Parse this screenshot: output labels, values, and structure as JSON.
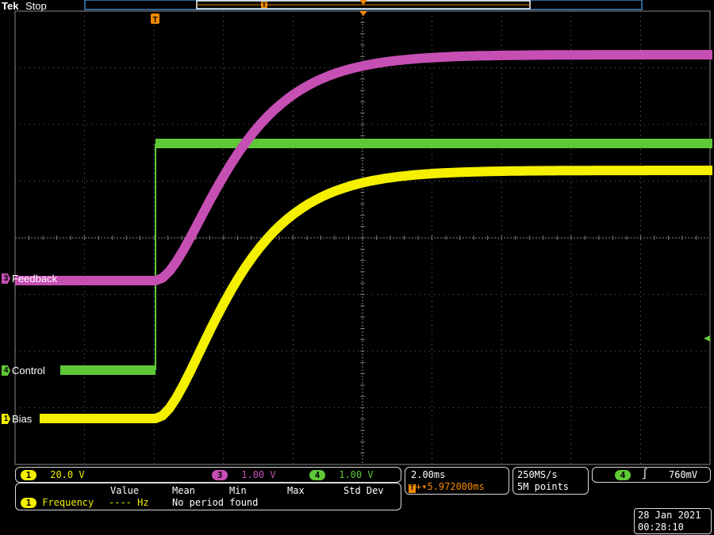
{
  "brand": "Tek",
  "acq_state": "Stop",
  "channels": {
    "ch1": {
      "num": "1",
      "label": "Bias",
      "scale": "20.0 V",
      "color": "#f4f000"
    },
    "ch3": {
      "num": "3",
      "label": "Feedback",
      "scale": "1.00 V",
      "color": "#c64fb4"
    },
    "ch4": {
      "num": "4",
      "label": "Control",
      "scale": "1.00 V",
      "color": "#5fc837"
    }
  },
  "horizontal": {
    "scale": "2.00ms",
    "trigger_position": "5.972000ms"
  },
  "acquisition": {
    "sample_rate": "250MS/s",
    "record_length": "5M points"
  },
  "trigger": {
    "source": "4",
    "slope_icon": "rising-edge-icon",
    "level": "760mV"
  },
  "measurement": {
    "headers": [
      "Value",
      "Mean",
      "Min",
      "Max",
      "Std Dev"
    ],
    "source": "1",
    "name": "Frequency",
    "value": "----",
    "unit": "Hz",
    "message": "No period found"
  },
  "datetime": {
    "date": "28 Jan  2021",
    "time": "00:28:10"
  },
  "colors": {
    "grid": "#8a8a8a",
    "trigger_marker": "#f08a00",
    "frame": "#3a86c8",
    "ch1": "#f4f000",
    "ch3": "#c64fb4",
    "ch4": "#5fc837"
  }
}
